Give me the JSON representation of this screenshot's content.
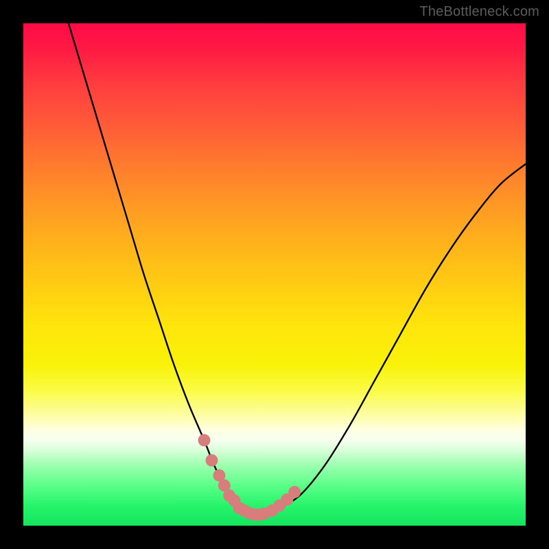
{
  "watermark": "TheBottleneck.com",
  "colors": {
    "page_bg": "#000000",
    "curve": "#000000",
    "highlight": "#d77e7c"
  },
  "chart_data": {
    "type": "line",
    "title": "",
    "xlabel": "",
    "ylabel": "",
    "xlim": [
      0,
      100
    ],
    "ylim": [
      0,
      100
    ],
    "grid": false,
    "series": [
      {
        "name": "curve",
        "x": [
          9,
          12,
          15,
          18,
          21,
          24,
          27,
          30,
          33,
          36,
          38,
          40,
          42,
          44,
          46,
          48,
          50,
          55,
          60,
          65,
          70,
          75,
          80,
          85,
          90,
          95,
          100
        ],
        "y": [
          100,
          90,
          80,
          70,
          60,
          50,
          41,
          32,
          24,
          17,
          12,
          8,
          5,
          3,
          2,
          2,
          3,
          6,
          12,
          20,
          29,
          38,
          47,
          55,
          62,
          68,
          72
        ]
      }
    ],
    "highlight": {
      "x": [
        36,
        37.5,
        39,
        40,
        41,
        42,
        43,
        44,
        45,
        46,
        47,
        48,
        49.5,
        51,
        52.5,
        54
      ],
      "y": [
        17,
        13,
        10,
        8,
        6,
        5,
        3.5,
        3,
        2.5,
        2.2,
        2.2,
        2.4,
        3,
        4,
        5.2,
        6.7
      ]
    },
    "background_gradient": [
      "#ff0b46",
      "#ff9825",
      "#ffe50c",
      "#ffffe3",
      "#14e45e"
    ]
  }
}
